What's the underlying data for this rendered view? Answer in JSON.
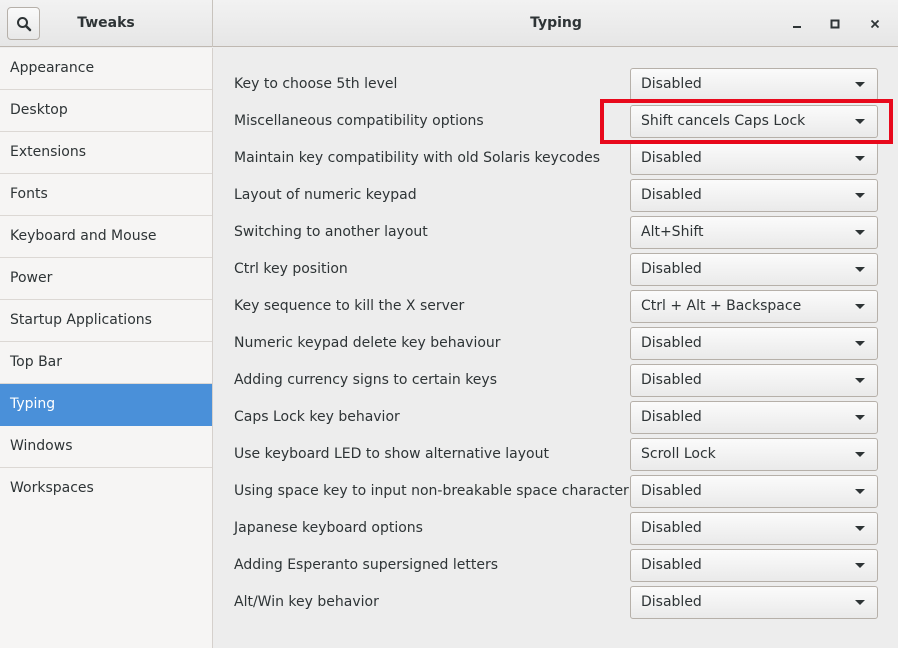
{
  "app": {
    "title": "Tweaks"
  },
  "page": {
    "title": "Typing"
  },
  "icons": {
    "search": "search-icon",
    "minimize": "minimize-icon",
    "maximize": "maximize-icon",
    "close": "close-icon",
    "dropdown": "dropdown-arrow-icon"
  },
  "colors": {
    "accent": "#4a90d9",
    "highlight": "#e8091c"
  },
  "sidebar": {
    "items": [
      {
        "label": "Appearance"
      },
      {
        "label": "Desktop"
      },
      {
        "label": "Extensions"
      },
      {
        "label": "Fonts"
      },
      {
        "label": "Keyboard and Mouse"
      },
      {
        "label": "Power"
      },
      {
        "label": "Startup Applications"
      },
      {
        "label": "Top Bar"
      },
      {
        "label": "Typing",
        "selected": true
      },
      {
        "label": "Windows"
      },
      {
        "label": "Workspaces"
      }
    ]
  },
  "settings": [
    {
      "label": "Key to choose 5th level",
      "value": "Disabled"
    },
    {
      "label": "Miscellaneous compatibility options",
      "value": "Shift cancels Caps Lock",
      "highlighted": true
    },
    {
      "label": "Maintain key compatibility with old Solaris keycodes",
      "value": "Disabled"
    },
    {
      "label": "Layout of numeric keypad",
      "value": "Disabled"
    },
    {
      "label": "Switching to another layout",
      "value": "Alt+Shift"
    },
    {
      "label": "Ctrl key position",
      "value": "Disabled"
    },
    {
      "label": "Key sequence to kill the X server",
      "value": "Ctrl + Alt + Backspace"
    },
    {
      "label": "Numeric keypad delete key behaviour",
      "value": "Disabled"
    },
    {
      "label": "Adding currency signs to certain keys",
      "value": "Disabled"
    },
    {
      "label": "Caps Lock key behavior",
      "value": "Disabled"
    },
    {
      "label": "Use keyboard LED to show alternative layout",
      "value": "Scroll Lock"
    },
    {
      "label": "Using space key to input non-breakable space character",
      "value": "Disabled"
    },
    {
      "label": "Japanese keyboard options",
      "value": "Disabled"
    },
    {
      "label": "Adding Esperanto supersigned letters",
      "value": "Disabled"
    },
    {
      "label": "Alt/Win key behavior",
      "value": "Disabled"
    }
  ]
}
